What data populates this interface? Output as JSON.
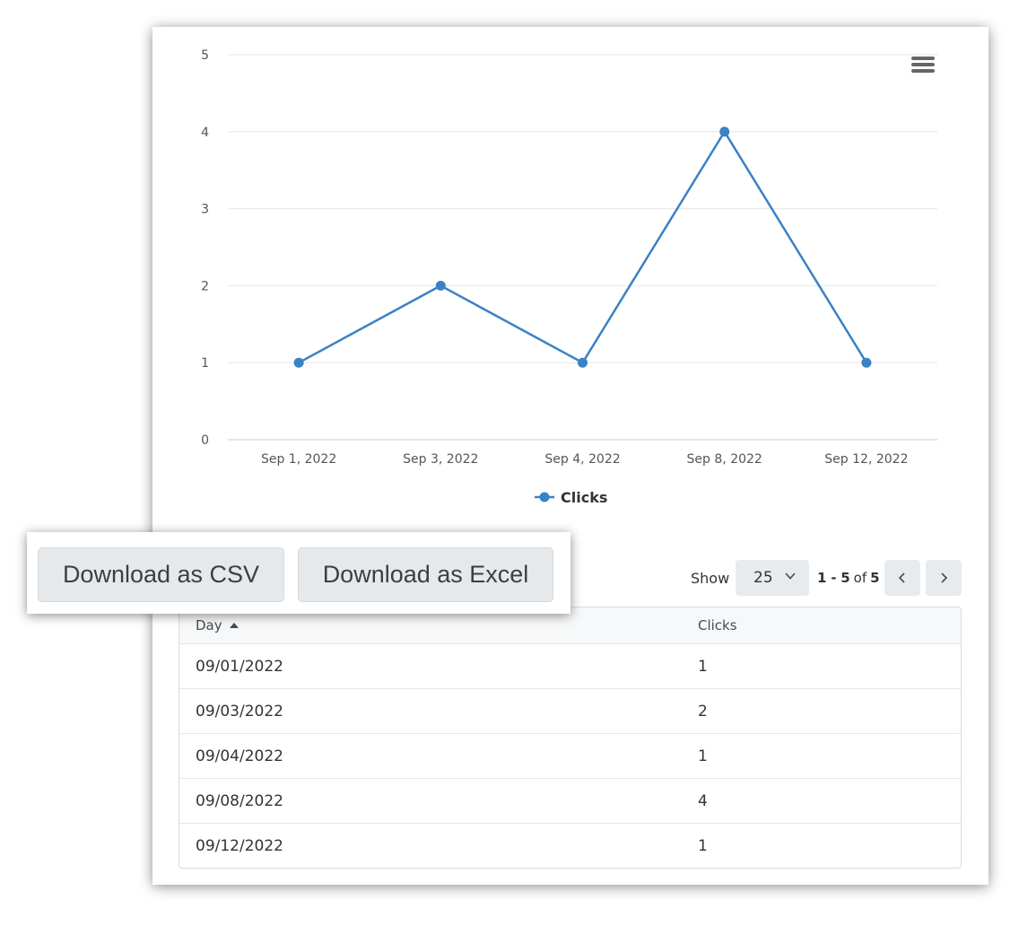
{
  "chart_data": {
    "type": "line",
    "categories": [
      "Sep 1, 2022",
      "Sep 3, 2022",
      "Sep 4, 2022",
      "Sep 8, 2022",
      "Sep 12, 2022"
    ],
    "series": [
      {
        "name": "Clicks",
        "values": [
          1,
          2,
          1,
          4,
          1
        ],
        "color": "#3b82c4"
      }
    ],
    "yticks": [
      0,
      1,
      2,
      3,
      4,
      5
    ],
    "ylim": [
      0,
      5
    ],
    "grid": true,
    "legend": "bottom-center"
  },
  "chart_menu": {
    "icon": "hamburger-menu-icon"
  },
  "download": {
    "csv_label": "Download as CSV",
    "excel_label": "Download as Excel"
  },
  "pager": {
    "show_label": "Show",
    "page_size": "25",
    "range_start": "1",
    "range_sep": "-",
    "range_end": "5",
    "of_label": "of",
    "total": "5"
  },
  "table": {
    "columns": [
      "Day",
      "Clicks"
    ],
    "sort": {
      "column": "Day",
      "direction": "ascending"
    },
    "rows": [
      {
        "day": "09/01/2022",
        "clicks": "1"
      },
      {
        "day": "09/03/2022",
        "clicks": "2"
      },
      {
        "day": "09/04/2022",
        "clicks": "1"
      },
      {
        "day": "09/08/2022",
        "clicks": "4"
      },
      {
        "day": "09/12/2022",
        "clicks": "1"
      }
    ]
  }
}
